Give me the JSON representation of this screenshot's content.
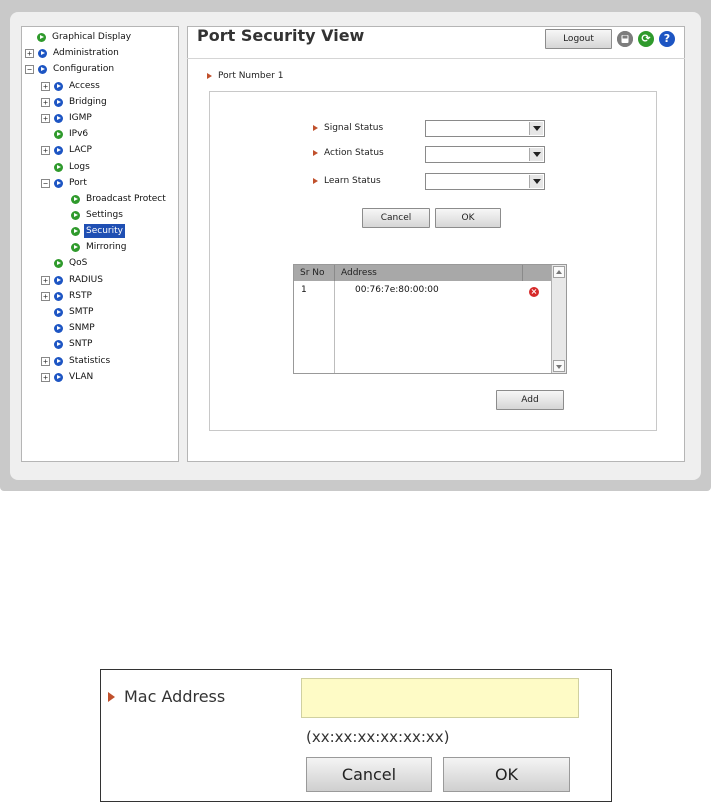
{
  "header": {
    "title": "Port Security View",
    "logout_label": "Logout"
  },
  "sidebar": {
    "items": [
      {
        "label": "Graphical Display"
      },
      {
        "label": "Administration"
      },
      {
        "label": "Configuration"
      },
      {
        "label": "Access"
      },
      {
        "label": "Bridging"
      },
      {
        "label": "IGMP"
      },
      {
        "label": "IPv6"
      },
      {
        "label": "LACP"
      },
      {
        "label": "Logs"
      },
      {
        "label": "Port"
      },
      {
        "label": "Broadcast Protect"
      },
      {
        "label": "Settings"
      },
      {
        "label": "Security"
      },
      {
        "label": "Mirroring"
      },
      {
        "label": "QoS"
      },
      {
        "label": "RADIUS"
      },
      {
        "label": "RSTP"
      },
      {
        "label": "SMTP"
      },
      {
        "label": "SNMP"
      },
      {
        "label": "SNTP"
      },
      {
        "label": "Statistics"
      },
      {
        "label": "VLAN"
      }
    ]
  },
  "main": {
    "port_label": "Port Number 1",
    "signal_status_label": "Signal Status",
    "action_status_label": "Action Status",
    "learn_status_label": "Learn Status",
    "signal_status_value": "",
    "action_status_value": "",
    "learn_status_value": "",
    "cancel_label": "Cancel",
    "ok_label": "OK",
    "add_label": "Add",
    "table": {
      "columns": [
        "Sr No",
        "Address"
      ],
      "rows": [
        {
          "sr_no": "1",
          "address": "00:76:7e:80:00:00"
        }
      ]
    }
  },
  "detail": {
    "mac_label": "Mac Address",
    "mac_value": "",
    "format_hint": "(xx:xx:xx:xx:xx:xx)",
    "cancel_label": "Cancel",
    "ok_label": "OK"
  },
  "colors": {
    "accent_arrow": "#c0502c",
    "selected": "#1f4fb3",
    "input_highlight": "#fefbc6"
  }
}
